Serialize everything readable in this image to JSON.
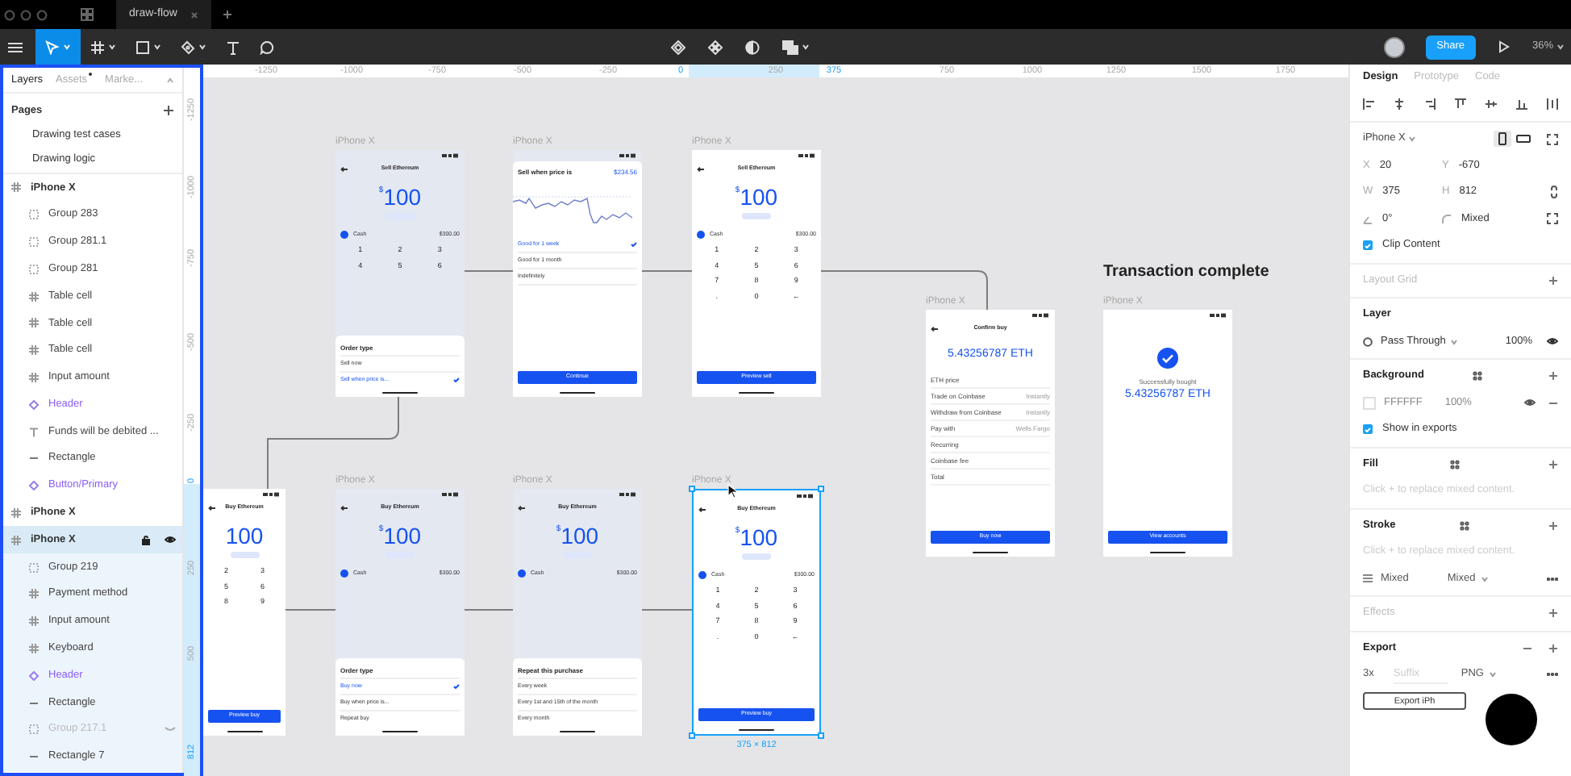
{
  "tabs": [
    {
      "label": "draw-flow",
      "selected": true
    }
  ],
  "toolbar": {
    "tools": [
      {
        "selected": true
      },
      {
        "selected": false
      },
      {
        "selected": false
      },
      {
        "selected": false
      },
      {
        "selected": false
      },
      {
        "selected": false
      }
    ],
    "share_button": "Share",
    "zoom": "36%"
  },
  "left_panel": {
    "tabs": [
      {
        "label": "Layers",
        "selected": true,
        "has_update": false
      },
      {
        "label": "Assets",
        "selected": false,
        "has_update": true
      },
      {
        "label": "Marke...",
        "selected": false,
        "has_update": false
      }
    ],
    "pages_title": "Pages",
    "pages": [
      "Drawing test cases",
      "Drawing logic"
    ],
    "layers": [
      {
        "name": "iPhone X",
        "kind": "frame",
        "selected": false,
        "children": [
          {
            "name": "Group 283",
            "kind": "group",
            "selected": false,
            "hidden": false
          },
          {
            "name": "Group 281.1",
            "kind": "group",
            "selected": false,
            "hidden": false
          },
          {
            "name": "Group 281",
            "kind": "group",
            "selected": false,
            "hidden": false
          },
          {
            "name": "Table cell",
            "kind": "frame",
            "selected": false,
            "hidden": false
          },
          {
            "name": "Table cell",
            "kind": "frame",
            "selected": false,
            "hidden": false
          },
          {
            "name": "Table cell",
            "kind": "frame",
            "selected": false,
            "hidden": false
          },
          {
            "name": "Input amount",
            "kind": "frame",
            "selected": false,
            "hidden": false
          },
          {
            "name": "Header",
            "kind": "component",
            "selected": false,
            "hidden": false
          },
          {
            "name": "Funds will be debited ...",
            "kind": "text",
            "selected": false,
            "hidden": false
          },
          {
            "name": "Rectangle",
            "kind": "line",
            "selected": false,
            "hidden": false
          },
          {
            "name": "Button/Primary",
            "kind": "component",
            "selected": false,
            "hidden": false
          }
        ]
      },
      {
        "name": "iPhone X",
        "kind": "frame",
        "selected": false
      },
      {
        "name": "iPhone X",
        "kind": "frame",
        "selected": true,
        "children": [
          {
            "name": "Group 219",
            "kind": "group",
            "selected": false,
            "hidden": false
          },
          {
            "name": "Payment method",
            "kind": "frame",
            "selected": false,
            "hidden": false
          },
          {
            "name": "Input amount",
            "kind": "frame",
            "selected": false,
            "hidden": false
          },
          {
            "name": "Keyboard",
            "kind": "frame",
            "selected": false,
            "hidden": false
          },
          {
            "name": "Header",
            "kind": "component",
            "selected": false,
            "hidden": false
          },
          {
            "name": "Rectangle",
            "kind": "line",
            "selected": false,
            "hidden": false
          },
          {
            "name": "Group 217.1",
            "kind": "group",
            "selected": false,
            "hidden": true
          },
          {
            "name": "Rectangle 7",
            "kind": "line",
            "selected": false,
            "hidden": false
          }
        ]
      }
    ]
  },
  "rulers": {
    "top": [
      {
        "label": "-1250",
        "highlighted": false
      },
      {
        "label": "-1000",
        "highlighted": false
      },
      {
        "label": "-750",
        "highlighted": false
      },
      {
        "label": "-500",
        "highlighted": false
      },
      {
        "label": "-250",
        "highlighted": false
      },
      {
        "label": "0",
        "highlighted": true
      },
      {
        "label": "250",
        "highlighted": false
      },
      {
        "label": "375",
        "highlighted": true
      },
      {
        "label": "750",
        "highlighted": false
      },
      {
        "label": "1000",
        "highlighted": false
      },
      {
        "label": "1250",
        "highlighted": false
      },
      {
        "label": "1500",
        "highlighted": false
      },
      {
        "label": "1750",
        "highlighted": false
      }
    ],
    "left": [
      {
        "label": "-1250",
        "highlighted": false
      },
      {
        "label": "-1000",
        "highlighted": false
      },
      {
        "label": "-750",
        "highlighted": false
      },
      {
        "label": "-500",
        "highlighted": false
      },
      {
        "label": "-250",
        "highlighted": false
      },
      {
        "label": "0",
        "highlighted": true
      },
      {
        "label": "250",
        "highlighted": false
      },
      {
        "label": "500",
        "highlighted": false
      },
      {
        "label": "812",
        "highlighted": true
      }
    ]
  },
  "canvas": {
    "heading": "Transaction complete",
    "selection_size": "375 × 812",
    "frames": [
      {
        "label": "iPhone X",
        "selected": false,
        "dimmed": true,
        "cropped": false,
        "blocks": [
          {
            "kind": "header",
            "title": "Sell Ethereum"
          },
          {
            "kind": "amount",
            "currency": "$",
            "value": "100"
          },
          {
            "kind": "funding",
            "label": "Cash",
            "value": "$300.00"
          },
          {
            "kind": "keypad",
            "keys": [
              "1",
              "2",
              "3",
              "4",
              "5",
              "6"
            ]
          },
          {
            "kind": "sheet",
            "title": "Order type",
            "options": [
              {
                "label": "Sell now",
                "selected": false
              },
              {
                "label": "Sell when price is...",
                "selected": true
              }
            ]
          }
        ]
      },
      {
        "label": "iPhone X",
        "selected": false,
        "dimmed": true,
        "cropped": false,
        "blocks": [
          {
            "kind": "chart_sheet",
            "title": "Sell when price is",
            "value": "$234.56",
            "options": [
              {
                "label": "Good for 1 week",
                "selected": true
              },
              {
                "label": "Good for 1 month",
                "selected": false
              },
              {
                "label": "Indefinitely",
                "selected": false
              }
            ],
            "button": "Continue"
          }
        ]
      },
      {
        "label": "iPhone X",
        "selected": false,
        "dimmed": false,
        "cropped": false,
        "blocks": [
          {
            "kind": "header",
            "title": "Sell Ethereum"
          },
          {
            "kind": "amount",
            "currency": "$",
            "value": "100"
          },
          {
            "kind": "funding",
            "label": "Cash",
            "value": "$300.00"
          },
          {
            "kind": "keypad",
            "keys": [
              "1",
              "2",
              "3",
              "4",
              "5",
              "6",
              "7",
              "8",
              "9",
              ".",
              "0",
              "←"
            ]
          },
          {
            "kind": "button",
            "label": "Preview sell"
          }
        ]
      },
      {
        "selected": false,
        "dimmed": false,
        "cropped": true,
        "blocks": [
          {
            "kind": "header",
            "title": "Buy Ethereum"
          },
          {
            "kind": "amount",
            "value": "100"
          },
          {
            "kind": "keypad",
            "keys": [
              "2",
              "3",
              "5",
              "6",
              "8",
              "9"
            ]
          },
          {
            "kind": "button",
            "label": "Preview buy"
          }
        ]
      },
      {
        "label": "iPhone X",
        "selected": false,
        "dimmed": true,
        "cropped": false,
        "blocks": [
          {
            "kind": "header",
            "title": "Buy Ethereum"
          },
          {
            "kind": "amount",
            "currency": "$",
            "value": "100"
          },
          {
            "kind": "funding",
            "label": "Cash",
            "value": "$300.00"
          },
          {
            "kind": "sheet",
            "title": "Order type",
            "options": [
              {
                "label": "Buy now",
                "selected": true
              },
              {
                "label": "Buy when price is...",
                "selected": false
              },
              {
                "label": "Repeat buy",
                "selected": false
              }
            ]
          }
        ]
      },
      {
        "label": "iPhone X",
        "selected": false,
        "dimmed": true,
        "cropped": false,
        "blocks": [
          {
            "kind": "header",
            "title": "Buy Ethereum"
          },
          {
            "kind": "amount",
            "currency": "$",
            "value": "100"
          },
          {
            "kind": "funding",
            "label": "Cash",
            "value": "$300.00"
          },
          {
            "kind": "sheet",
            "title": "Repeat this purchase",
            "options": [
              {
                "label": "Every week",
                "selected": false
              },
              {
                "label": "Every 1st and 15th of the month",
                "selected": false
              },
              {
                "label": "Every month",
                "selected": false
              }
            ]
          }
        ]
      },
      {
        "label": "iPhone X",
        "selected": true,
        "dimmed": false,
        "cropped": false,
        "blocks": [
          {
            "kind": "header",
            "title": "Buy Ethereum"
          },
          {
            "kind": "amount",
            "currency": "$",
            "value": "100"
          },
          {
            "kind": "funding",
            "label": "Cash",
            "value": "$300.00"
          },
          {
            "kind": "keypad",
            "keys": [
              "1",
              "2",
              "3",
              "4",
              "5",
              "6",
              "7",
              "8",
              "9",
              ".",
              "0",
              "←"
            ]
          },
          {
            "kind": "button",
            "label": "Preview buy"
          }
        ]
      },
      {
        "label": "iPhone X",
        "selected": false,
        "dimmed": false,
        "cropped": false,
        "blocks": [
          {
            "kind": "header",
            "title": "Confirm buy"
          },
          {
            "kind": "crypto",
            "value": "5.43256787 ETH"
          },
          {
            "kind": "details",
            "rows": [
              {
                "label": "ETH price"
              },
              {
                "label": "Trade on Coinbase",
                "value": "Instantly"
              },
              {
                "label": "Withdraw from Coinbase",
                "value": "Instantly"
              },
              {
                "label": "Pay with",
                "value": "Wells Fargo"
              },
              {
                "label": "Recurring"
              },
              {
                "label": "Coinbase fee"
              },
              {
                "label": "Total"
              }
            ]
          },
          {
            "kind": "button",
            "label": "Buy now"
          }
        ]
      },
      {
        "label": "iPhone X",
        "selected": false,
        "dimmed": false,
        "cropped": false,
        "blocks": [
          {
            "kind": "success",
            "caption": "Successfully bought",
            "value": "5.43256787 ETH"
          },
          {
            "kind": "button",
            "label": "View accounts"
          }
        ]
      }
    ]
  },
  "design_panel": {
    "tabs": [
      {
        "label": "Design",
        "selected": true
      },
      {
        "label": "Prototype",
        "selected": false
      },
      {
        "label": "Code",
        "selected": false
      }
    ],
    "frame_preset": "iPhone X",
    "orientations": [
      {
        "selected": true
      },
      {
        "selected": false
      }
    ],
    "fields": [
      {
        "label": "X",
        "value": "20"
      },
      {
        "label": "Y",
        "value": "-670"
      },
      {
        "label": "W",
        "value": "375"
      },
      {
        "label": "H",
        "value": "812"
      },
      {
        "value": "0°"
      },
      {
        "value": "Mixed"
      }
    ],
    "clip_content": {
      "label": "Clip Content",
      "checked": true
    },
    "layout_grid": {
      "title": "Layout Grid"
    },
    "layer": {
      "title": "Layer",
      "blend": "Pass Through",
      "opacity": "100%"
    },
    "background": {
      "title": "Background",
      "color": "FFFFFF",
      "opacity": "100%",
      "show_in_exports": {
        "label": "Show in exports",
        "checked": true
      }
    },
    "fill": {
      "title": "Fill",
      "hint": "Click + to replace mixed content."
    },
    "stroke": {
      "title": "Stroke",
      "hint": "Click + to replace mixed content.",
      "weight": "Mixed",
      "position": "Mixed"
    },
    "effects": {
      "title": "Effects"
    },
    "export": {
      "title": "Export",
      "scale": "3x",
      "suffix": {
        "placeholder": "Suffix"
      },
      "format": "PNG",
      "button": "Export iPh"
    }
  }
}
